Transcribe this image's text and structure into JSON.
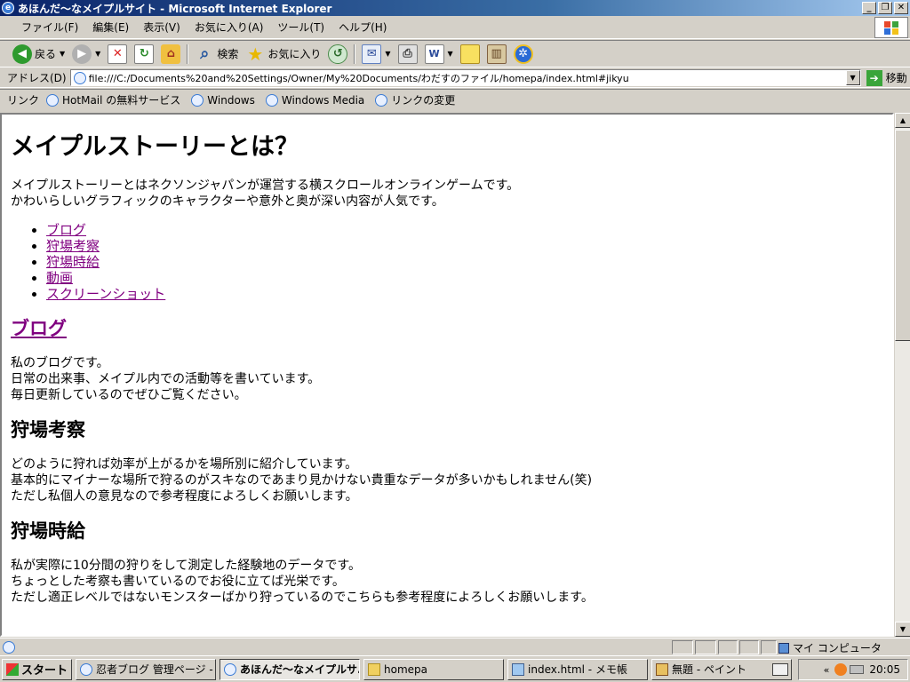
{
  "window": {
    "title": "あほんだ～なメイプルサイト - Microsoft Internet Explorer"
  },
  "menu": [
    "ファイル(F)",
    "編集(E)",
    "表示(V)",
    "お気に入り(A)",
    "ツール(T)",
    "ヘルプ(H)"
  ],
  "toolbar": {
    "back": "戻る",
    "search": "検索",
    "favorites": "お気に入り"
  },
  "address": {
    "label": "アドレス(D)",
    "url": "file:///C:/Documents%20and%20Settings/Owner/My%20Documents/わだすのファイル/homepa/index.html#jikyu",
    "go": "移動"
  },
  "links": {
    "label": "リンク",
    "items": [
      "HotMail の無料サービス",
      "Windows",
      "Windows Media",
      "リンクの変更"
    ]
  },
  "page": {
    "h1": "メイプルストーリーとは？",
    "intro": [
      "メイプルストーリーとはネクソンジャパンが運営する横スクロールオンラインゲームです。",
      "かわいらしいグラフィックのキャラクターや意外と奥が深い内容が人気です。"
    ],
    "nav": [
      "ブログ",
      "狩場考察",
      "狩場時給",
      "動画",
      "スクリーンショット"
    ],
    "s1": {
      "title": "ブログ",
      "lines": [
        "私のブログです。",
        "日常の出来事、メイプル内での活動等を書いています。",
        "毎日更新しているのでぜひご覧ください。"
      ]
    },
    "s2": {
      "title": "狩場考察",
      "lines": [
        "どのように狩れば効率が上がるかを場所別に紹介しています。",
        "基本的にマイナーな場所で狩るのがスキなのであまり見かけない貴重なデータが多いかもしれません(笑)",
        "ただし私個人の意見なので参考程度によろしくお願いします。"
      ]
    },
    "s3": {
      "title": "狩場時給",
      "lines": [
        "私が実際に10分間の狩りをして測定した経験地のデータです。",
        "ちょっとした考察も書いているのでお役に立てば光栄です。",
        "ただし適正レベルではないモンスターばかり狩っているのでこちらも参考程度によろしくお願いします。"
      ]
    }
  },
  "status": {
    "zone": "マイ コンピュータ"
  },
  "taskbar": {
    "start": "スタート",
    "tasks": [
      "忍者ブログ 管理ページ - ...",
      "あほんだ～なメイプルサ...",
      "homepa",
      "index.html - メモ帳",
      "無題 - ペイント"
    ],
    "clock": "20:05"
  }
}
